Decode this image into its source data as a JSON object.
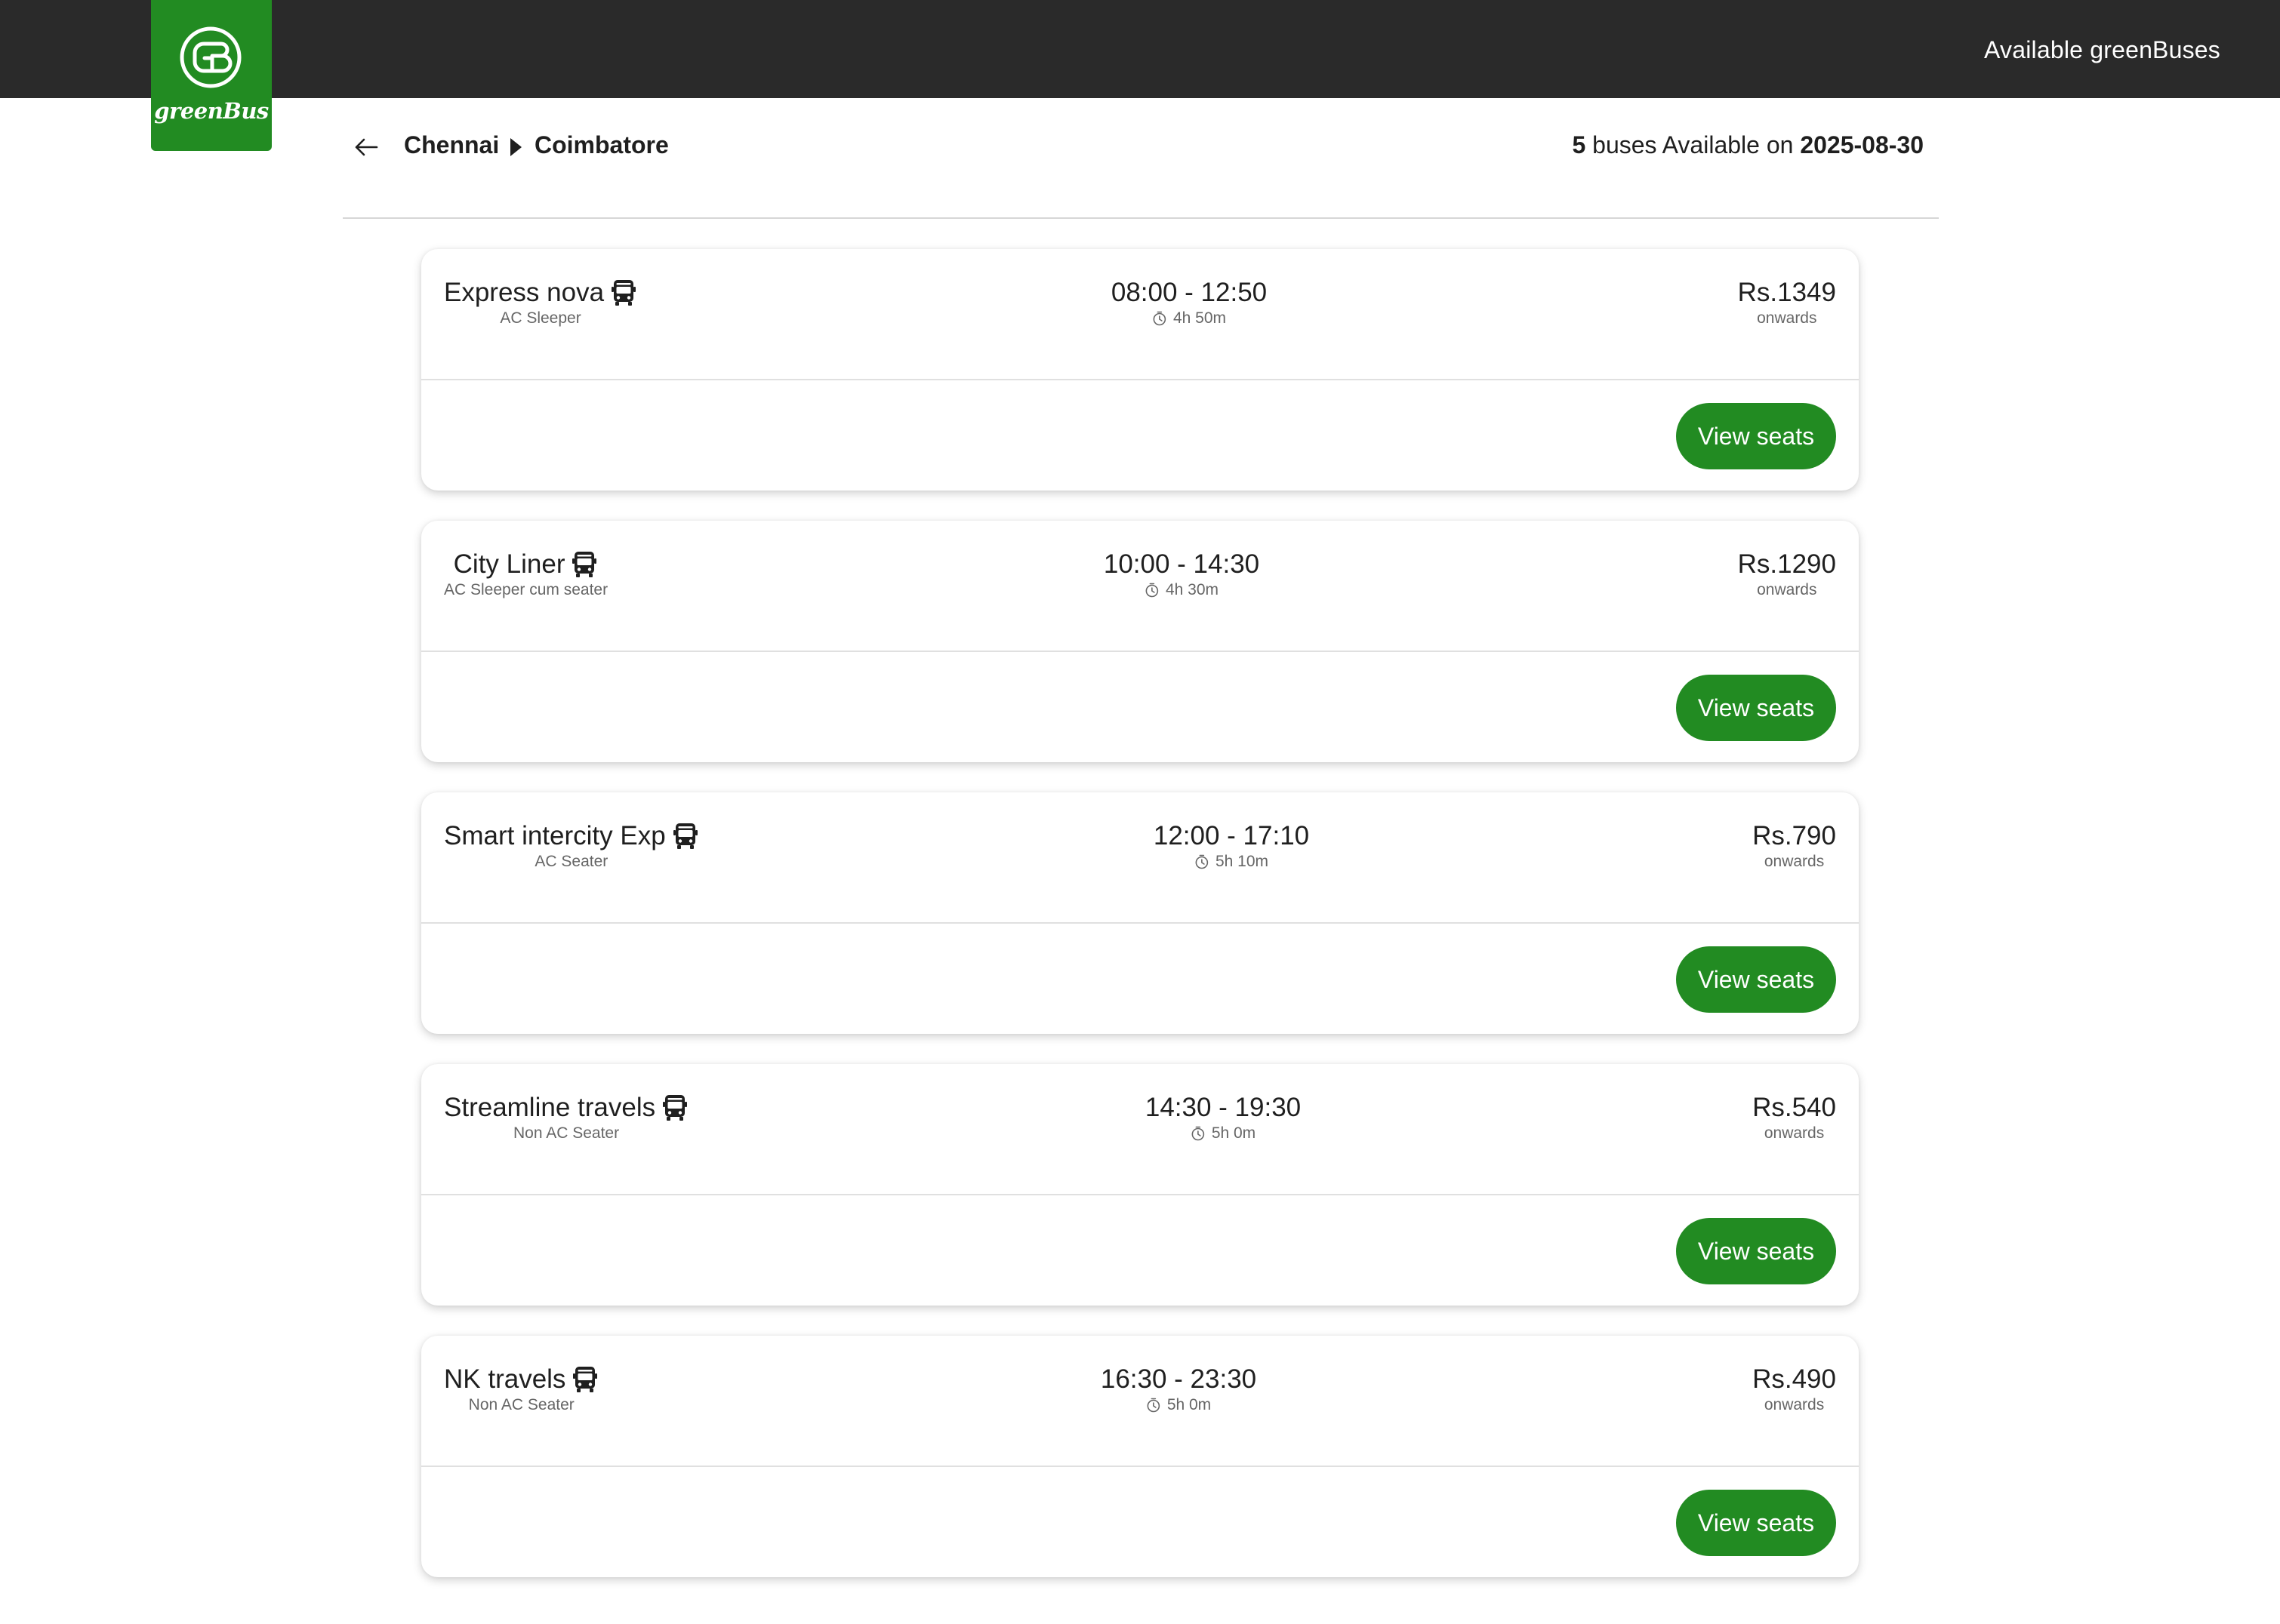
{
  "header": {
    "title": "Available greenBuses",
    "logo_text": "greenBus",
    "logo_monogram": "GB"
  },
  "route": {
    "from": "Chennai",
    "to": "Coimbatore",
    "count": "5",
    "summary_text": " buses Available on ",
    "date": "2025-08-30"
  },
  "buses": [
    {
      "name": "Express nova",
      "type": "AC Sleeper",
      "time": "08:00 - 12:50",
      "duration": "4h 50m",
      "price": "Rs.1349",
      "onwards": "onwards",
      "button": "View seats"
    },
    {
      "name": "City Liner",
      "type": "AC Sleeper cum seater",
      "time": "10:00 - 14:30",
      "duration": "4h 30m",
      "price": "Rs.1290",
      "onwards": "onwards",
      "button": "View seats"
    },
    {
      "name": "Smart intercity Exp",
      "type": "AC Seater",
      "time": "12:00 - 17:10",
      "duration": "5h 10m",
      "price": "Rs.790",
      "onwards": "onwards",
      "button": "View seats"
    },
    {
      "name": "Streamline travels",
      "type": "Non AC Seater",
      "time": "14:30 - 19:30",
      "duration": "5h 0m",
      "price": "Rs.540",
      "onwards": "onwards",
      "button": "View seats"
    },
    {
      "name": "NK travels",
      "type": "Non AC Seater",
      "time": "16:30 - 23:30",
      "duration": "5h 0m",
      "price": "Rs.490",
      "onwards": "onwards",
      "button": "View seats"
    }
  ],
  "icons": {
    "bus": "bus-icon",
    "clock": "clock-icon",
    "back": "back-arrow-icon",
    "caret": "caret-right-icon"
  },
  "colors": {
    "brand": "#228b22",
    "topbar": "#2a2a2a"
  }
}
